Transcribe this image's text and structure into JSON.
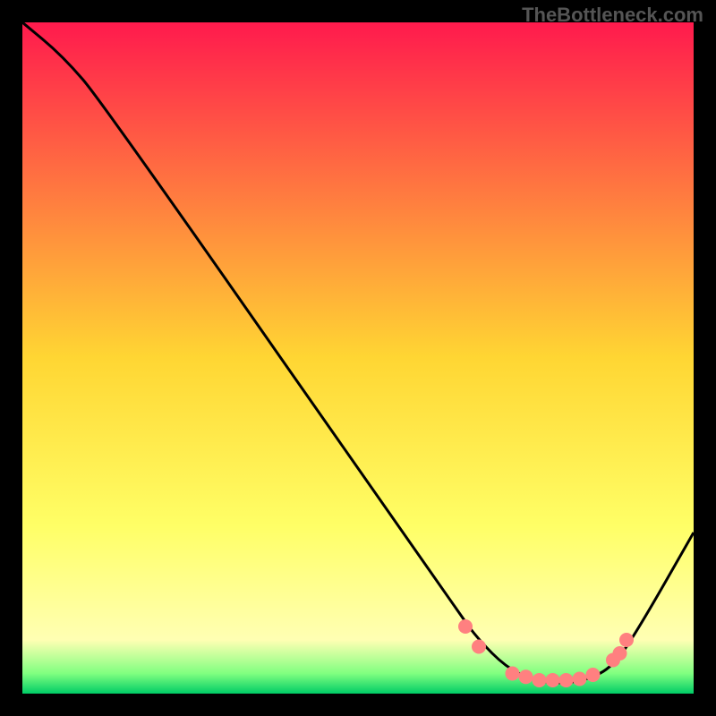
{
  "watermark": "TheBottleneck.com",
  "chart_data": {
    "type": "line",
    "title": "",
    "xlabel": "",
    "ylabel": "",
    "xlim": [
      0,
      100
    ],
    "ylim": [
      0,
      100
    ],
    "gradient_stops": [
      {
        "offset": 0,
        "color": "#ff1a4d"
      },
      {
        "offset": 50,
        "color": "#ffd633"
      },
      {
        "offset": 75,
        "color": "#ffff66"
      },
      {
        "offset": 92,
        "color": "#ffffb3"
      },
      {
        "offset": 97,
        "color": "#80ff80"
      },
      {
        "offset": 100,
        "color": "#00cc66"
      }
    ],
    "curve": [
      {
        "x": 0,
        "y": 100
      },
      {
        "x": 6,
        "y": 95
      },
      {
        "x": 12,
        "y": 88
      },
      {
        "x": 65,
        "y": 12
      },
      {
        "x": 68,
        "y": 8
      },
      {
        "x": 72,
        "y": 4
      },
      {
        "x": 76,
        "y": 2
      },
      {
        "x": 80,
        "y": 1.5
      },
      {
        "x": 84,
        "y": 2
      },
      {
        "x": 88,
        "y": 4
      },
      {
        "x": 92,
        "y": 10
      },
      {
        "x": 100,
        "y": 24
      }
    ],
    "markers": [
      {
        "x": 66,
        "y": 10
      },
      {
        "x": 68,
        "y": 7
      },
      {
        "x": 73,
        "y": 3
      },
      {
        "x": 75,
        "y": 2.5
      },
      {
        "x": 77,
        "y": 2
      },
      {
        "x": 79,
        "y": 2
      },
      {
        "x": 81,
        "y": 2
      },
      {
        "x": 83,
        "y": 2.2
      },
      {
        "x": 85,
        "y": 2.8
      },
      {
        "x": 88,
        "y": 5
      },
      {
        "x": 89,
        "y": 6
      },
      {
        "x": 90,
        "y": 8
      }
    ],
    "marker_color": "#ff8080",
    "line_color": "#000000"
  }
}
